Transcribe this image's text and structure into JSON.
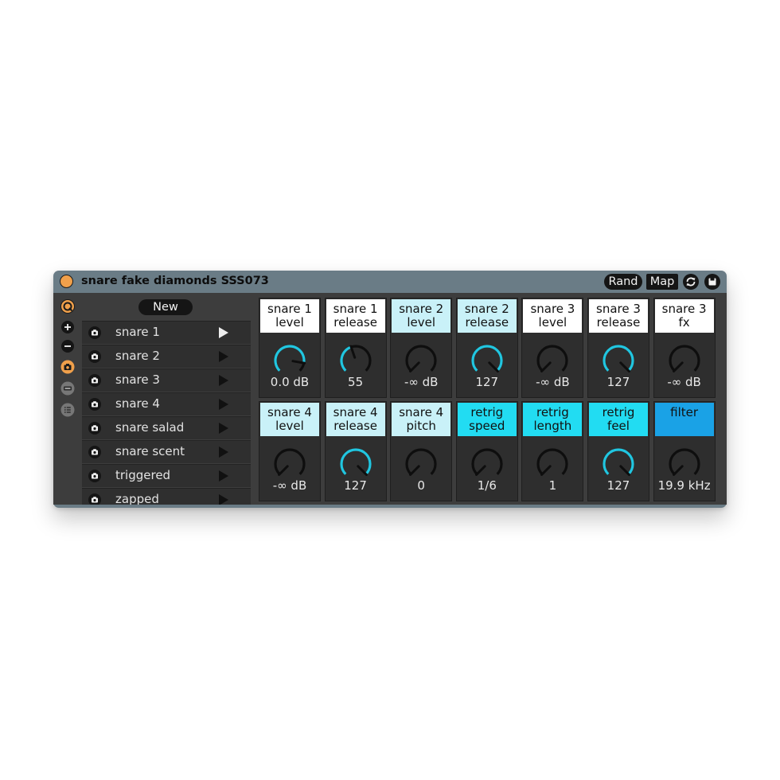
{
  "title": "snare fake diamonds SSS073",
  "header": {
    "rand_label": "Rand",
    "map_label": "Map",
    "random_icon": "refresh-icon",
    "save_icon": "save-icon"
  },
  "sidebar": {
    "icons": [
      "loop-icon",
      "plus-icon",
      "minus-icon",
      "camera-icon",
      "remove-icon",
      "list-icon"
    ]
  },
  "presets": {
    "new_label": "New",
    "items": [
      {
        "name": "snare 1",
        "active": true
      },
      {
        "name": "snare 2",
        "active": false
      },
      {
        "name": "snare 3",
        "active": false
      },
      {
        "name": "snare 4",
        "active": false
      },
      {
        "name": "snare salad",
        "active": false
      },
      {
        "name": "snare scent",
        "active": false
      },
      {
        "name": "triggered",
        "active": false
      },
      {
        "name": "zapped",
        "active": false
      }
    ]
  },
  "colors": {
    "accent": "#21c6e0",
    "label_white": "#ffffff",
    "label_light": "#c9f1f8",
    "label_cyan": "#22dcf2",
    "label_blue": "#1aa2e6",
    "power": "#f0a04b"
  },
  "params": [
    {
      "label": "snare 1\nlevel",
      "value": "0.0 dB",
      "color": "#ffffff",
      "level": 0.87,
      "arc": true
    },
    {
      "label": "snare 1\nrelease",
      "value": "55",
      "color": "#ffffff",
      "level": 0.43,
      "arc": true
    },
    {
      "label": "snare 2\nlevel",
      "value": "-∞ dB",
      "color": "#c9f1f8",
      "level": 0,
      "arc": false
    },
    {
      "label": "snare 2\nrelease",
      "value": "127",
      "color": "#c9f1f8",
      "level": 1,
      "arc": true
    },
    {
      "label": "snare 3\nlevel",
      "value": "-∞ dB",
      "color": "#ffffff",
      "level": 0,
      "arc": false
    },
    {
      "label": "snare 3\nrelease",
      "value": "127",
      "color": "#ffffff",
      "level": 1,
      "arc": true
    },
    {
      "label": "snare 3\nfx",
      "value": "-∞ dB",
      "color": "#ffffff",
      "level": 0,
      "arc": false
    },
    {
      "label": "snare 4\nlevel",
      "value": "-∞ dB",
      "color": "#c9f1f8",
      "level": 0,
      "arc": false
    },
    {
      "label": "snare 4\nrelease",
      "value": "127",
      "color": "#c9f1f8",
      "level": 1,
      "arc": true
    },
    {
      "label": "snare 4\npitch",
      "value": "0",
      "color": "#c9f1f8",
      "level": 0,
      "arc": false
    },
    {
      "label": "retrig\nspeed",
      "value": "1/6",
      "color": "#22dcf2",
      "level": 0,
      "arc": false
    },
    {
      "label": "retrig\nlength",
      "value": "1",
      "color": "#22dcf2",
      "level": 0,
      "arc": false
    },
    {
      "label": "retrig\nfeel",
      "value": "127",
      "color": "#22dcf2",
      "level": 1,
      "arc": true
    },
    {
      "label": "filter",
      "value": "19.9 kHz",
      "color": "#1aa2e6",
      "level": 0,
      "arc": false
    }
  ]
}
